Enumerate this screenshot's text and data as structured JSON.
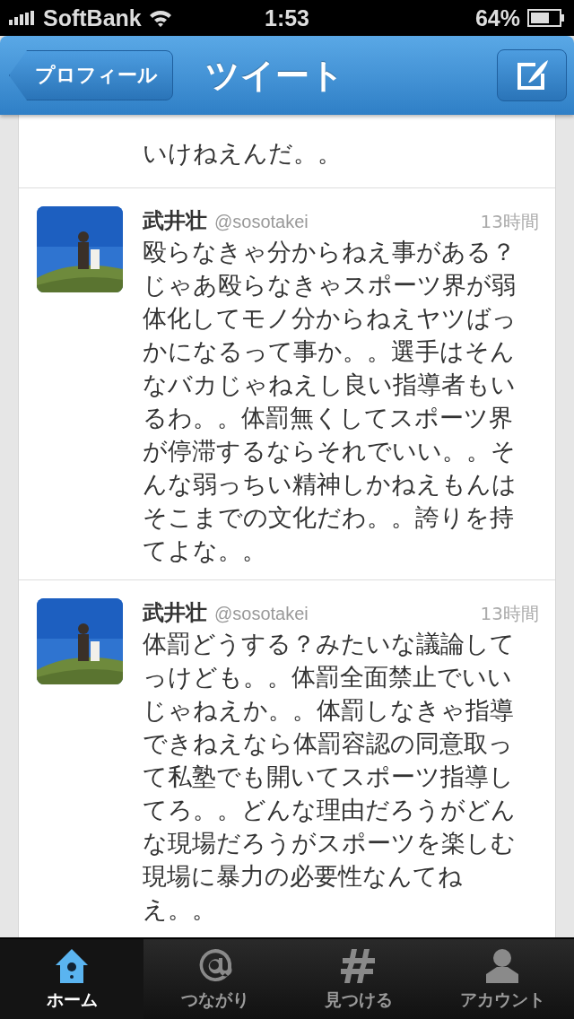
{
  "status_bar": {
    "carrier": "SoftBank",
    "time": "1:53",
    "battery": "64%"
  },
  "nav_bar": {
    "back_button": "プロフィール",
    "title": "ツイート"
  },
  "partial_tweet": {
    "text": "いけねえんだ。。"
  },
  "tweets": [
    {
      "name": "武井壮",
      "handle": "@sosotakei",
      "time": "13時間",
      "text": "殴らなきゃ分からねえ事がある？じゃあ殴らなきゃスポーツ界が弱体化してモノ分からねえヤツばっかになるって事か。。選手はそんなバカじゃねえし良い指導者もいるわ。。体罰無くしてスポーツ界が停滞するならそれでいい。。そんな弱っちい精神しかねえもんはそこまでの文化だわ。。誇りを持てよな。。"
    },
    {
      "name": "武井壮",
      "handle": "@sosotakei",
      "time": "13時間",
      "text": "体罰どうする？みたいな議論してっけども。。体罰全面禁止でいいじゃねえか。。体罰しなきゃ指導できねえなら体罰容認の同意取って私塾でも開いてスポーツ指導してろ。。どんな理由だろうがどんな現場だろうがスポーツを楽しむ現場に暴力の必要性なんてねえ。。"
    }
  ],
  "tab_bar": [
    {
      "label": "ホーム",
      "kind": "home",
      "selected": true
    },
    {
      "label": "つながり",
      "kind": "at",
      "selected": false
    },
    {
      "label": "見つける",
      "kind": "hash",
      "selected": false
    },
    {
      "label": "アカウント",
      "kind": "person",
      "selected": false
    }
  ]
}
